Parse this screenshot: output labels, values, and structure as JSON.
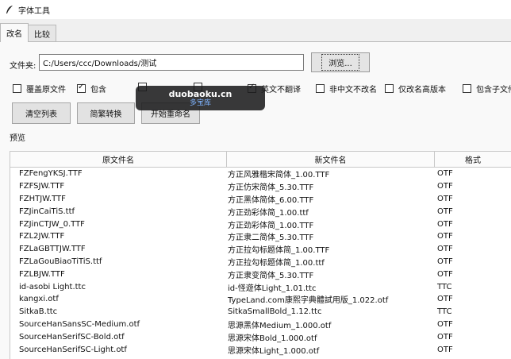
{
  "window": {
    "title": "字体工具",
    "icon": "feather-icon"
  },
  "tabs": [
    {
      "label": "改名",
      "active": true
    },
    {
      "label": "比较",
      "active": false
    }
  ],
  "folder": {
    "label": "文件夹:",
    "value": "C:/Users/ccc/Downloads/测试",
    "browse_label": "浏览..."
  },
  "options": [
    {
      "label": "覆盖原文件",
      "checked": false
    },
    {
      "label": "包含",
      "checked": true
    },
    {
      "label": "",
      "checked": false
    },
    {
      "label": "",
      "checked": false
    },
    {
      "label": "英文不翻译",
      "checked": true
    },
    {
      "label": "非中文不改名",
      "checked": false
    },
    {
      "label": "仅改名高版本",
      "checked": false
    },
    {
      "label": "包含子文件夹",
      "checked": false
    }
  ],
  "actions": {
    "clear": "清空列表",
    "convert": "简繁转换",
    "rename": "开始重命名"
  },
  "overlay": {
    "line1": "duobaoku.cn",
    "line2": "多宝库"
  },
  "preview": {
    "label": "预览"
  },
  "table": {
    "headers": [
      "原文件名",
      "新文件名",
      "格式"
    ],
    "rows": [
      [
        "FZFengYKSJ.TTF",
        "方正风雅楷宋简体_1.00.TTF",
        "OTF"
      ],
      [
        "FZFSJW.TTF",
        "方正仿宋简体_5.30.TTF",
        "OTF"
      ],
      [
        "FZHTJW.TTF",
        "方正黑体简体_6.00.TTF",
        "OTF"
      ],
      [
        "FZJinCaiTiS.ttf",
        "方正劲彩体简_1.00.ttf",
        "OTF"
      ],
      [
        "FZJinCTJW_0.TTF",
        "方正劲彩体简_1.00.TTF",
        "OTF"
      ],
      [
        "FZL2JW.TTF",
        "方正隶二简体_5.30.TTF",
        "OTF"
      ],
      [
        "FZLaGBTTJW.TTF",
        "方正拉勾标题体简_1.00.TTF",
        "OTF"
      ],
      [
        "FZLaGouBiaoTiTiS.ttf",
        "方正拉勾标题体简_1.00.ttf",
        "OTF"
      ],
      [
        "FZLBJW.TTF",
        "方正隶变简体_5.30.TTF",
        "OTF"
      ],
      [
        "id-asobi Light.ttc",
        "id-怪遊体Light_1.01.ttc",
        "TTC"
      ],
      [
        "kangxi.otf",
        "TypeLand.com康熙字典體試用版_1.022.otf",
        "OTF"
      ],
      [
        "SitkaB.ttc",
        "SitkaSmallBold_1.12.ttc",
        "TTC"
      ],
      [
        "SourceHanSansSC-Medium.otf",
        "思源黑体Medium_1.000.otf",
        "OTF"
      ],
      [
        "SourceHanSerifSC-Bold.otf",
        "思源宋体Bold_1.000.otf",
        "OTF"
      ],
      [
        "SourceHanSerifSC-Light.otf",
        "思源宋体Light_1.000.otf",
        "OTF"
      ]
    ]
  }
}
